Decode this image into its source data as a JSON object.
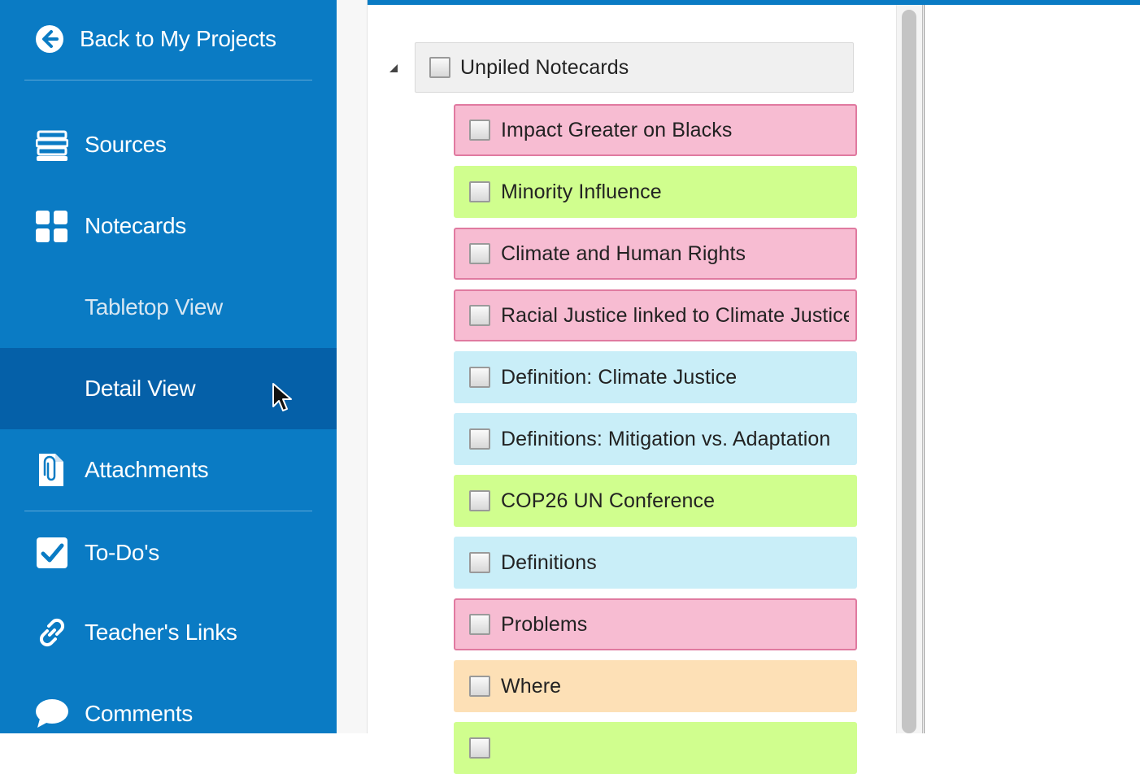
{
  "sidebar": {
    "back_label": "Back to My Projects",
    "items": [
      {
        "label": "Sources",
        "icon": "sources-icon"
      },
      {
        "label": "Notecards",
        "icon": "grid-icon"
      },
      {
        "label": "Tabletop View"
      },
      {
        "label": "Detail View"
      },
      {
        "label": "Attachments",
        "icon": "attachment-icon"
      },
      {
        "label": "To-Do's",
        "icon": "checkbox-icon"
      },
      {
        "label": "Teacher's Links",
        "icon": "link-icon"
      },
      {
        "label": "Comments",
        "icon": "comment-icon"
      }
    ],
    "active_item": "Detail View",
    "colors": {
      "background": "#0a7bc4",
      "active": "#0560a8"
    }
  },
  "tree": {
    "root_label": "Unpiled Notecards",
    "cards": [
      {
        "label": "Impact Greater on Blacks",
        "color": "#f7bcd2",
        "border": "#e07aa0"
      },
      {
        "label": "Minority Influence",
        "color": "#d0fe8e",
        "border": "#d0fe8e"
      },
      {
        "label": "Climate and Human Rights",
        "color": "#f7bcd2",
        "border": "#e07aa0"
      },
      {
        "label": "Racial Justice linked to Climate Justice",
        "color": "#f7bcd2",
        "border": "#e07aa0"
      },
      {
        "label": "Definition: Climate Justice",
        "color": "#c9eef8",
        "border": "#c9eef8"
      },
      {
        "label": "Definitions: Mitigation vs. Adaptation",
        "color": "#c9eef8",
        "border": "#c9eef8"
      },
      {
        "label": "COP26 UN Conference",
        "color": "#d0fe8e",
        "border": "#d0fe8e"
      },
      {
        "label": "Definitions",
        "color": "#c9eef8",
        "border": "#c9eef8"
      },
      {
        "label": "Problems",
        "color": "#f7bcd2",
        "border": "#e07aa0"
      },
      {
        "label": "Where",
        "color": "#fde0b6",
        "border": "#fde0b6"
      },
      {
        "label": "",
        "color": "#d0fe8e",
        "border": "#d0fe8e"
      }
    ]
  }
}
